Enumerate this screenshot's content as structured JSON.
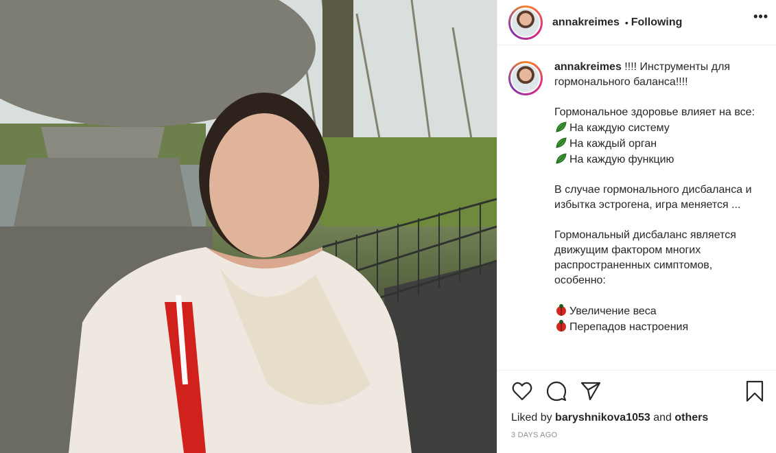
{
  "post": {
    "author": "annakreimes",
    "separator": "•",
    "follow_state": "Following",
    "more_label": "•••"
  },
  "caption": {
    "username": "annakreimes",
    "lines": [
      "!!!! Инструменты для гормонального баланса!!!!",
      "Гормональное здоровье влияет на все:",
      "На каждую систему",
      "На каждый орган",
      "На каждую функцию",
      "В случае гормонального дисбаланса и избытка эстрогена, игра меняется ...",
      "Гормональный дисбаланс является движущим фактором многих распространенных симптомов, особенно:",
      "Увеличение веса",
      "Перепадов настроения"
    ]
  },
  "likes": {
    "prefix": "Liked by",
    "user": "baryshnikova1053",
    "middle": "and",
    "suffix": "others"
  },
  "timestamp": "3 DAYS AGO",
  "icons": {
    "like": "heart-icon",
    "comment": "comment-icon",
    "share": "share-icon",
    "save": "bookmark-icon",
    "more": "more-options-icon",
    "bullet_green": "leaf-icon",
    "bullet_red": "lady-beetle-icon"
  },
  "colors": {
    "accent_ring": "#dd2a7b",
    "text": "#262626",
    "muted": "#8e8e8e",
    "border": "#efefef"
  }
}
